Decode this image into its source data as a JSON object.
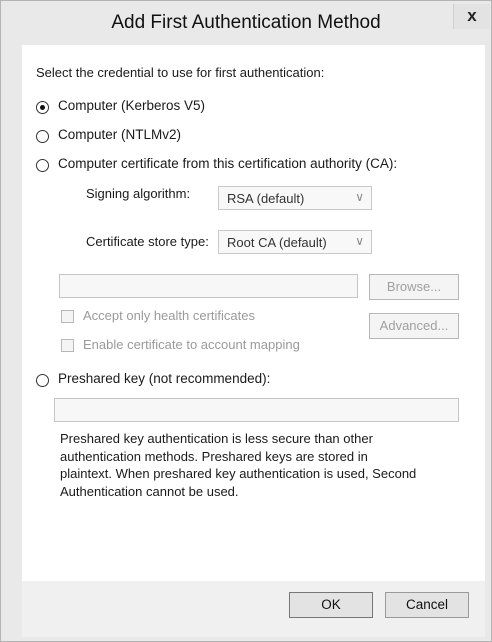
{
  "dialog": {
    "title": "Add First Authentication Method",
    "close_label": "x"
  },
  "instruction": "Select the credential to use for first authentication:",
  "options": {
    "kerberos": {
      "label": "Computer (Kerberos V5)",
      "selected": true
    },
    "ntlm": {
      "label": "Computer (NTLMv2)",
      "selected": false
    },
    "certificate": {
      "label": "Computer certificate from this certification authority (CA):",
      "selected": false
    },
    "preshared": {
      "label": "Preshared key (not recommended):",
      "selected": false
    }
  },
  "certificate": {
    "signing_label": "Signing algorithm:",
    "signing_value": "RSA (default)",
    "store_label": "Certificate store type:",
    "store_value": "Root CA (default)",
    "browse_label": "Browse...",
    "advanced_label": "Advanced...",
    "health_label": "Accept only health certificates",
    "mapping_label": "Enable certificate to account mapping",
    "ca_value": ""
  },
  "preshared": {
    "key_value": "",
    "note": "Preshared key authentication is less secure than other authentication methods. Preshared keys are stored in plaintext. When preshared key authentication is used, Second Authentication cannot be used."
  },
  "buttons": {
    "ok": "OK",
    "cancel": "Cancel"
  },
  "colors": {
    "window_bg": "#e9e9e9",
    "client_bg": "#ffffff",
    "disabled_text": "#9a9a9a"
  },
  "icons": {
    "combo_arrow": "∨"
  }
}
